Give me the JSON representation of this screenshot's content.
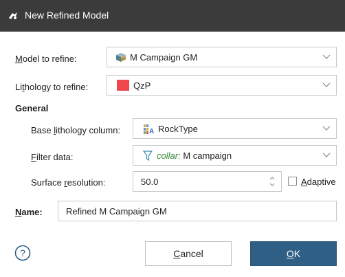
{
  "window": {
    "title": "New Refined Model",
    "app_icon": "leapfrog-app-icon"
  },
  "model_to_refine": {
    "label_pre": "",
    "label_u": "M",
    "label_post": "odel to refine:",
    "value": "M Campaign GM",
    "icon": "geological-model-icon"
  },
  "lithology_to_refine": {
    "label_pre": "Li",
    "label_u": "t",
    "label_post": "hology to refine:",
    "value": "QzP",
    "swatch_color": "#f0474f"
  },
  "general": {
    "heading": "General",
    "base_lithology": {
      "label_pre": "Base ",
      "label_u": "l",
      "label_post": "ithology column:",
      "value": "RockType",
      "icon": "lithology-column-icon"
    },
    "filter_data": {
      "label_pre": "",
      "label_u": "F",
      "label_post": "ilter data:",
      "value_prefix": "collar:",
      "value": "M campaign",
      "prefix_color": "#3a8a3a",
      "icon": "filter-icon"
    },
    "surface_resolution": {
      "label_pre": "Surface ",
      "label_u": "r",
      "label_post": "esolution:",
      "value": "50.0",
      "adaptive_label_u": "A",
      "adaptive_label_post": "daptive",
      "adaptive_checked": false
    }
  },
  "name": {
    "label_u": "N",
    "label_post": "ame:",
    "value": "Refined M Campaign GM"
  },
  "buttons": {
    "cancel_u": "C",
    "cancel_post": "ancel",
    "ok_u": "O",
    "ok_post": "K",
    "help_glyph": "?"
  },
  "colors": {
    "titlebar": "#3b3b3b",
    "primary_button": "#2f5f84"
  }
}
